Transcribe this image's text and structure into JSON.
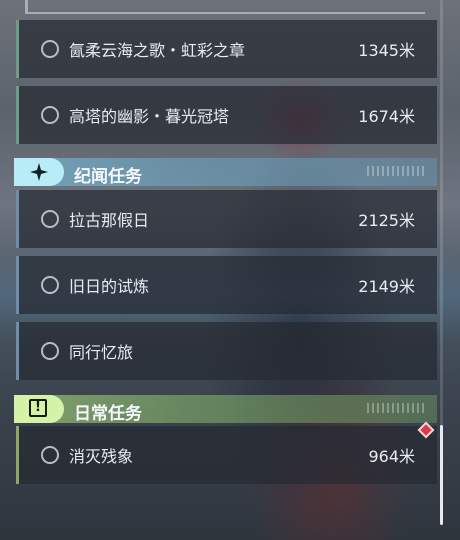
{
  "sections": [
    {
      "tasks": [
        {
          "name": "氤柔云海之歌・虹彩之章",
          "distance": "1345米"
        },
        {
          "name": "高塔的幽影・暮光冠塔",
          "distance": "1674米"
        }
      ]
    },
    {
      "title": "纪闻任务",
      "icon": "sparkle-star-icon",
      "accent": "#b8ecf7",
      "tasks": [
        {
          "name": "拉古那假日",
          "distance": "2125米"
        },
        {
          "name": "旧日的试炼",
          "distance": "2149米"
        },
        {
          "name": "同行忆旅",
          "distance": ""
        }
      ]
    },
    {
      "title": "日常任务",
      "icon": "alert-square-icon",
      "accent": "#d5f3a6",
      "tasks": [
        {
          "name": "消灭残象",
          "distance": "964米"
        }
      ]
    }
  ],
  "colors": {
    "lore_accent": "#6c8ea8",
    "daily_accent": "#8ea668",
    "alert_marker": "#d83a48"
  }
}
